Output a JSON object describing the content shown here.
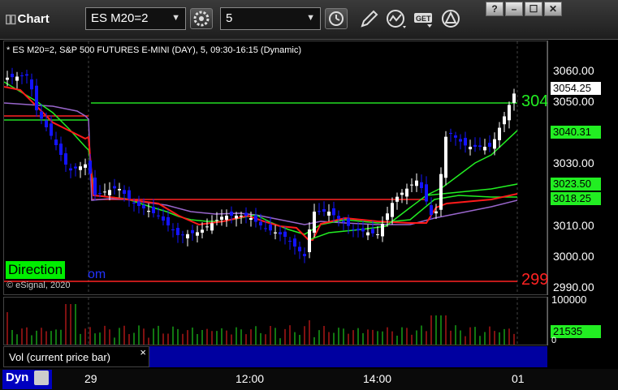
{
  "toolbar": {
    "app_title": "Chart",
    "symbol": "ES M20=2",
    "interval": "5"
  },
  "window_buttons": [
    "?",
    "–",
    "☐",
    "✕"
  ],
  "chart": {
    "header": "* ES M20=2, S&P 500 FUTURES E-MINI (DAY), 5, 09:30-16:15 (Dynamic)",
    "direction_label": "Direction",
    "copyright": "© eSignal, 2020",
    "partial_blue_text": "om",
    "line_label_green": "304",
    "line_label_red": "299"
  },
  "price_axis": {
    "ticks": [
      "3060.00",
      "3050.00",
      "3040.00",
      "3030.00",
      "3020.00",
      "3010.00",
      "3000.00",
      "2990.00"
    ],
    "last_price": "3054.25",
    "ma_green": "3040.31",
    "ma_2": "3023.50",
    "ma_3": "3018.25",
    "partial": "30??.??"
  },
  "volume": {
    "label": "Vol (current price bar)",
    "close_glyph": "×",
    "axis_top": "100000",
    "current": "21535",
    "axis_bottom": "0"
  },
  "bottom": {
    "dyn": "Dyn",
    "time_ticks": [
      "29",
      "12:00",
      "14:00",
      "01"
    ]
  },
  "colors": {
    "up": "#ffffff",
    "down": "#1414ff",
    "ma_red": "#ff1a1a",
    "ma_green": "#22ee22",
    "ma_purple": "#9966cc",
    "level_green": "#22dd22",
    "level_red": "#ff2222"
  },
  "chart_data": {
    "type": "candlestick",
    "price_range": [
      2990,
      3062
    ],
    "levels": {
      "green": 3049.5,
      "red_top": 3018.5,
      "red_bottom": 2992.5
    }
  }
}
